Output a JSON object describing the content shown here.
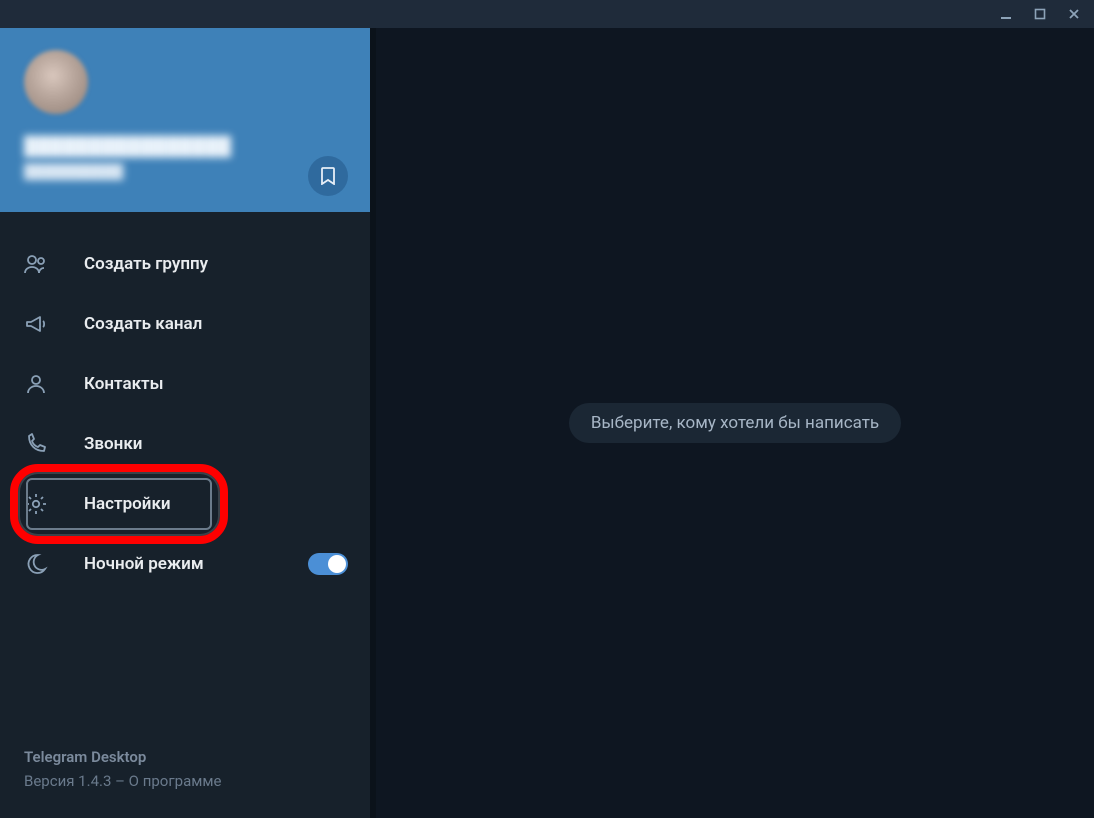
{
  "window": {
    "controls": {
      "minimize": "minimize",
      "maximize": "maximize",
      "close": "close"
    }
  },
  "profile": {
    "name_masked": "████████████████",
    "sub_masked": "██████████",
    "bookmark_icon": "bookmark-icon"
  },
  "menu": {
    "items": [
      {
        "key": "new-group",
        "icon": "group-icon",
        "label": "Создать группу"
      },
      {
        "key": "new-channel",
        "icon": "megaphone-icon",
        "label": "Создать канал"
      },
      {
        "key": "contacts",
        "icon": "person-icon",
        "label": "Контакты"
      },
      {
        "key": "calls",
        "icon": "phone-icon",
        "label": "Звонки"
      },
      {
        "key": "settings",
        "icon": "gear-icon",
        "label": "Настройки",
        "highlighted": true
      },
      {
        "key": "night-mode",
        "icon": "moon-icon",
        "label": "Ночной режим",
        "toggle": true,
        "toggle_on": true
      }
    ]
  },
  "footer": {
    "app_name": "Telegram Desktop",
    "version_line": "Версия 1.4.3 – О программе"
  },
  "main": {
    "placeholder": "Выберите, кому хотели бы написать"
  },
  "colors": {
    "accent": "#3e81b8",
    "bg_sidebar": "#17212b",
    "bg_main": "#0e1621",
    "highlight": "#ff0000"
  }
}
